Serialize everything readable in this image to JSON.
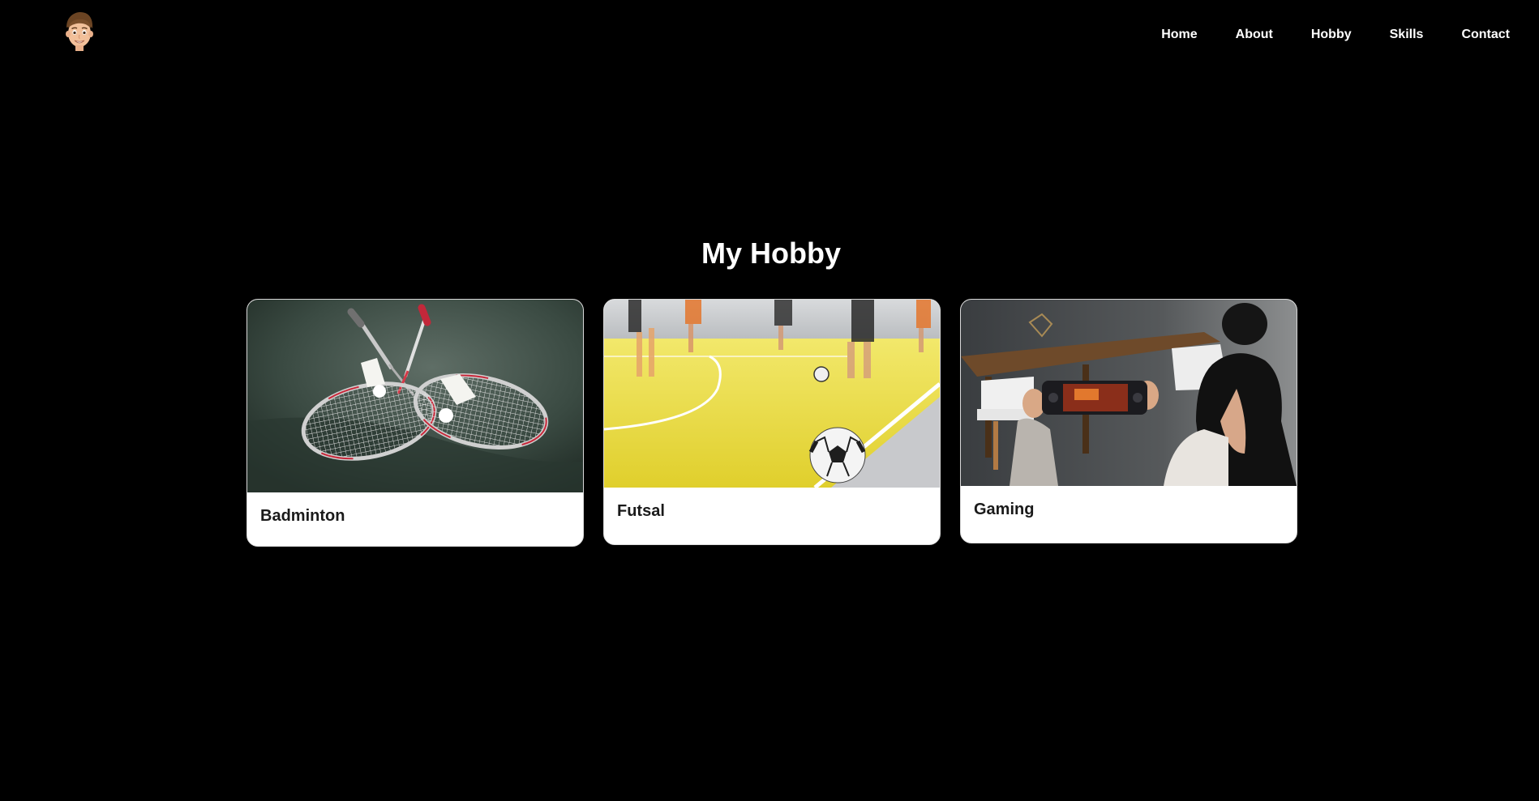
{
  "header": {
    "avatar_icon": "memoji-avatar-icon",
    "nav": [
      {
        "label": "Home"
      },
      {
        "label": "About"
      },
      {
        "label": "Hobby"
      },
      {
        "label": "Skills"
      },
      {
        "label": "Contact"
      }
    ]
  },
  "hobby": {
    "title": "My Hobby",
    "cards": [
      {
        "label": "Badminton",
        "image_icon": "badminton-rackets-shuttlecocks-photo"
      },
      {
        "label": "Futsal",
        "image_icon": "futsal-court-ball-photo"
      },
      {
        "label": "Gaming",
        "image_icon": "woman-mobile-gaming-photo"
      }
    ]
  },
  "colors": {
    "background": "#000000",
    "text": "#ffffff",
    "card_background": "#ffffff",
    "card_text": "#1a1a1a"
  }
}
